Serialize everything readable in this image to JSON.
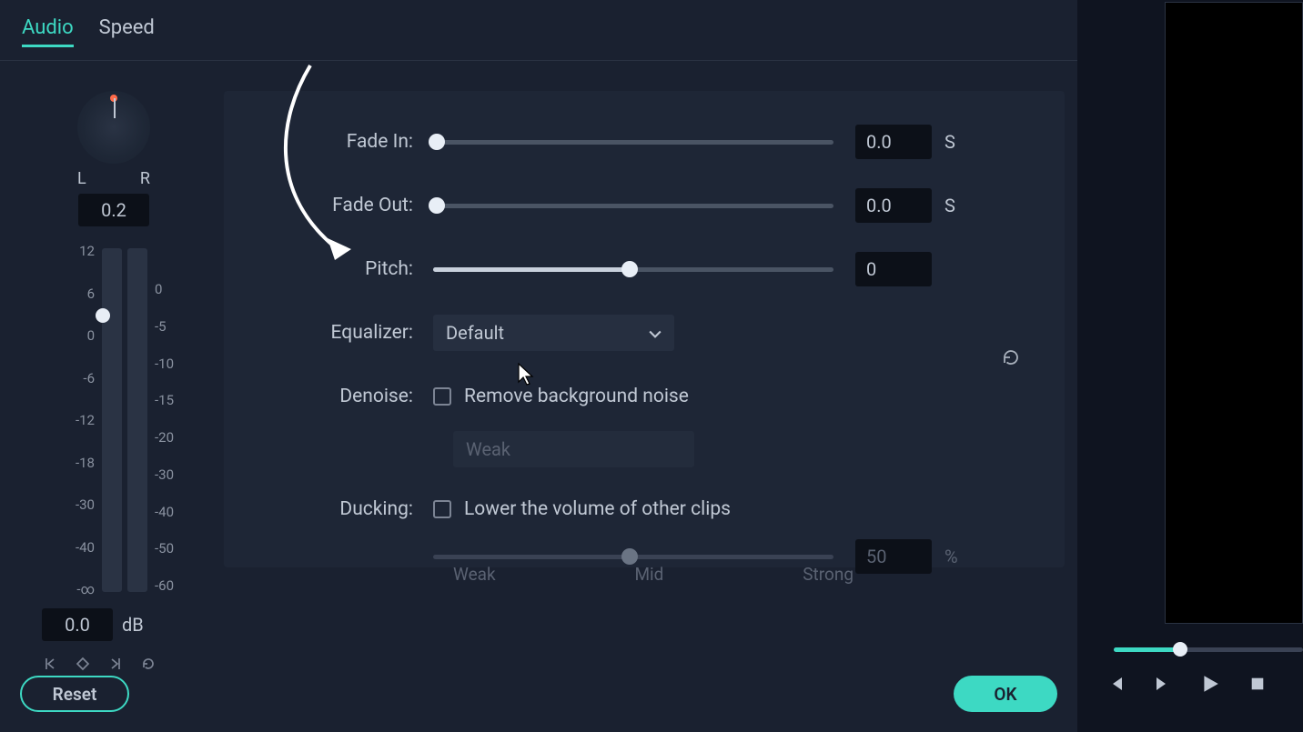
{
  "tabs": {
    "audio": "Audio",
    "speed": "Speed"
  },
  "balance": {
    "l": "L",
    "r": "R",
    "value": "0.2"
  },
  "meter": {
    "scale_left": [
      "12",
      "6",
      "0",
      "-6",
      "-12",
      "-18",
      "-30",
      "-40",
      "-∞"
    ],
    "scale_right": [
      "0",
      "-5",
      "-10",
      "-15",
      "-20",
      "-30",
      "-40",
      "-50",
      "-60"
    ],
    "db_value": "0.0",
    "db_unit": "dB"
  },
  "controls": {
    "fade_in": {
      "label": "Fade In:",
      "value": "0.0",
      "unit": "S"
    },
    "fade_out": {
      "label": "Fade Out:",
      "value": "0.0",
      "unit": "S"
    },
    "pitch": {
      "label": "Pitch:",
      "value": "0"
    },
    "equalizer": {
      "label": "Equalizer:",
      "value": "Default"
    },
    "denoise": {
      "label": "Denoise:",
      "checkbox_label": "Remove background noise",
      "level": "Weak"
    },
    "ducking": {
      "label": "Ducking:",
      "checkbox_label": "Lower the volume of other clips",
      "value": "50",
      "unit": "%",
      "ticks": {
        "weak": "Weak",
        "mid": "Mid",
        "strong": "Strong"
      }
    }
  },
  "buttons": {
    "reset": "Reset",
    "ok": "OK"
  }
}
